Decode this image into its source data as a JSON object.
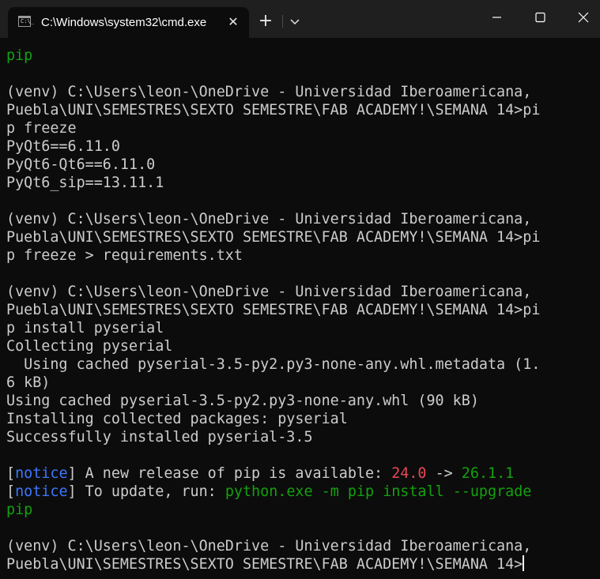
{
  "window": {
    "tab_title": "C:\\Windows\\system32\\cmd.exe",
    "tab_icon_text": "C:\\_",
    "close_tab_symbol": "✕",
    "new_tab_symbol": "+"
  },
  "colors": {
    "background": "#0c0c0c",
    "text": "#cccccc",
    "green": "#13a10e",
    "blue": "#3b78ff",
    "red": "#e74856"
  },
  "terminal": {
    "l01": "pip",
    "l02": "",
    "l03": "(venv) C:\\Users\\leon-\\OneDrive - Universidad Iberoamericana,",
    "l04": "Puebla\\UNI\\SEMESTRES\\SEXTO SEMESTRE\\FAB ACADEMY!\\SEMANA 14>pi",
    "l05": "p freeze",
    "l06": "PyQt6==6.11.0",
    "l07": "PyQt6-Qt6==6.11.0",
    "l08": "PyQt6_sip==13.11.1",
    "l09": "",
    "l10": "(venv) C:\\Users\\leon-\\OneDrive - Universidad Iberoamericana,",
    "l11": "Puebla\\UNI\\SEMESTRES\\SEXTO SEMESTRE\\FAB ACADEMY!\\SEMANA 14>pi",
    "l12": "p freeze > requirements.txt",
    "l13": "",
    "l14": "(venv) C:\\Users\\leon-\\OneDrive - Universidad Iberoamericana,",
    "l15": "Puebla\\UNI\\SEMESTRES\\SEXTO SEMESTRE\\FAB ACADEMY!\\SEMANA 14>pi",
    "l16": "p install pyserial",
    "l17": "Collecting pyserial",
    "l18": "  Using cached pyserial-3.5-py2.py3-none-any.whl.metadata (1.",
    "l19": "6 kB)",
    "l20": "Using cached pyserial-3.5-py2.py3-none-any.whl (90 kB)",
    "l21": "Installing collected packages: pyserial",
    "l22": "Successfully installed pyserial-3.5",
    "l23": "",
    "notice1": {
      "open": "[",
      "tag": "notice",
      "close": "]",
      "text": " A new release of pip is available: ",
      "old_version": "24.0",
      "arrow": " -> ",
      "new_version": "26.1.1"
    },
    "notice2": {
      "open": "[",
      "tag": "notice",
      "close": "]",
      "text": " To update, run: ",
      "command": "python.exe -m pip install --upgrade"
    },
    "l26": "pip",
    "l27": "",
    "l28": "(venv) C:\\Users\\leon-\\OneDrive - Universidad Iberoamericana,",
    "l29": "Puebla\\UNI\\SEMESTRES\\SEXTO SEMESTRE\\FAB ACADEMY!\\SEMANA 14>"
  }
}
